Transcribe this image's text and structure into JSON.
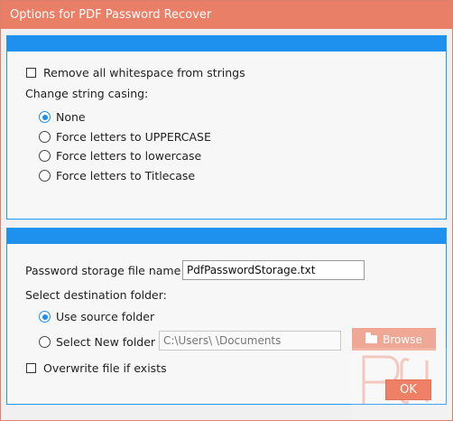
{
  "window": {
    "title": "Options for PDF Password Recover"
  },
  "strings_panel": {
    "remove_whitespace": {
      "label": "Remove all whitespace from strings",
      "checked": false
    },
    "casing_label": "Change string casing:",
    "casing_options": [
      {
        "label": "None",
        "selected": true
      },
      {
        "label": "Force letters to UPPERCASE",
        "selected": false
      },
      {
        "label": "Force letters to lowercase",
        "selected": false
      },
      {
        "label": "Force letters to Titlecase",
        "selected": false
      }
    ]
  },
  "storage_panel": {
    "file_name_label": "Password storage file name",
    "file_name_value": "PdfPasswordStorage.txt",
    "dest_label": "Select destination folder:",
    "use_source": {
      "label": "Use source folder",
      "selected": true
    },
    "new_folder": {
      "label": "Select New folder",
      "selected": false
    },
    "folder_path": "C:\\Users\\              \\Documents",
    "browse_label": "Browse",
    "overwrite": {
      "label": "Overwrite file if exists",
      "checked": false
    }
  },
  "ok_label": "OK",
  "colors": {
    "accent": "#1e90ee",
    "title_bar": "#e87f66",
    "ok_button": "#ed8065"
  }
}
